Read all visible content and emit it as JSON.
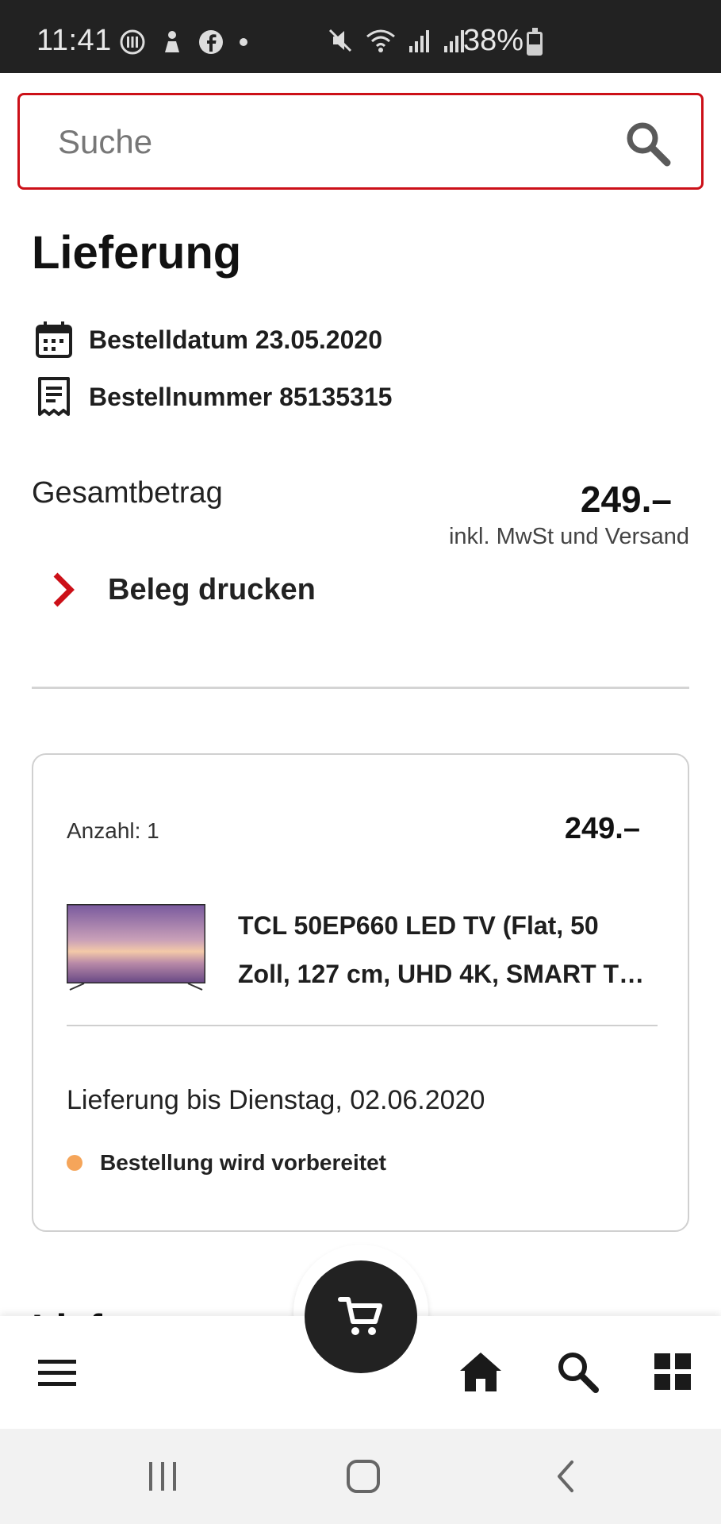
{
  "status_bar": {
    "time": "11:41",
    "battery": "38%"
  },
  "search": {
    "placeholder": "Suche"
  },
  "page": {
    "title": "Lieferung",
    "order_date": "Bestelldatum 23.05.2020",
    "order_number": "Bestellnummer 85135315",
    "total_label": "Gesamtbetrag",
    "total_value": "249.–",
    "total_note": "inkl. MwSt und Versand",
    "print_label": "Beleg drucken"
  },
  "order_card": {
    "quantity": "Anzahl: 1",
    "price": "249.–",
    "product_name": "TCL 50EP660 LED TV (Flat, 50 Zoll, 127 cm, UHD 4K, SMART T…",
    "delivery": "Lieferung bis Dienstag, 02.06.2020",
    "status": "Bestellung wird vorbereitet",
    "status_color": "#f5a55a"
  },
  "next_section_peek": "Lieferung",
  "colors": {
    "accent": "#cc1018",
    "dark": "#222222"
  },
  "bottom_nav": {
    "items": [
      "menu-icon",
      "cart-icon",
      "home-icon",
      "search-icon",
      "grid-icon"
    ]
  },
  "system_nav": {
    "items": [
      "recent-apps-icon",
      "home-button-icon",
      "back-icon"
    ]
  }
}
